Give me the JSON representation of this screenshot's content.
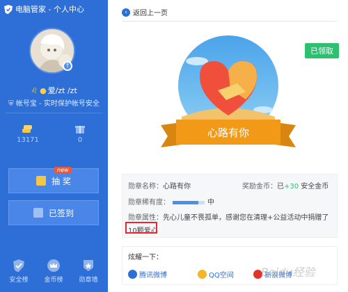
{
  "app": {
    "title": "电脑管家 - 个人中心"
  },
  "profile": {
    "username": "爱/zt /zt",
    "account_text": "帐号宝 - 实时保护帐号安全"
  },
  "stats": [
    {
      "icon": "coin-stack-icon",
      "value": "13171"
    },
    {
      "icon": "gift-icon",
      "value": "0"
    }
  ],
  "actions": {
    "lottery_label": "抽 奖",
    "lottery_tag": "new",
    "signin_label": "已签到"
  },
  "bottom_nav": [
    {
      "icon": "shield-check-icon",
      "label": "安全榜"
    },
    {
      "icon": "crown-icon",
      "label": "金币榜"
    },
    {
      "icon": "medal-icon",
      "label": "勋章墙"
    }
  ],
  "content": {
    "back_label": "返回上一页",
    "claimed_label": "已领取",
    "badge_ribbon": "心路有你",
    "info": {
      "name_label": "勋章名称：",
      "name_value": "心路有你",
      "reward_label": "奖励金币：",
      "reward_prefix": "已",
      "reward_amount": "+30",
      "reward_suffix": "安全金币",
      "rarity_label": "勋章稀有度：",
      "rarity_level": "中",
      "rarity_fraction": 0.8,
      "attr_label": "勋章属性：",
      "attr_text": "先心儿童不畏孤单，感谢您在清理+公益活动中捐赠了",
      "donation": "10颗爱心"
    },
    "share": {
      "title": "炫耀一下：",
      "options": [
        {
          "icon": "tencent-weibo-icon",
          "label": "腾讯微博",
          "color": "#2d6fd6"
        },
        {
          "icon": "qzone-icon",
          "label": "QQ空间",
          "color": "#f3b52a"
        },
        {
          "icon": "sina-weibo-icon",
          "label": "新浪微博",
          "color": "#e0332a"
        }
      ]
    }
  },
  "watermark": "Baidu经验"
}
